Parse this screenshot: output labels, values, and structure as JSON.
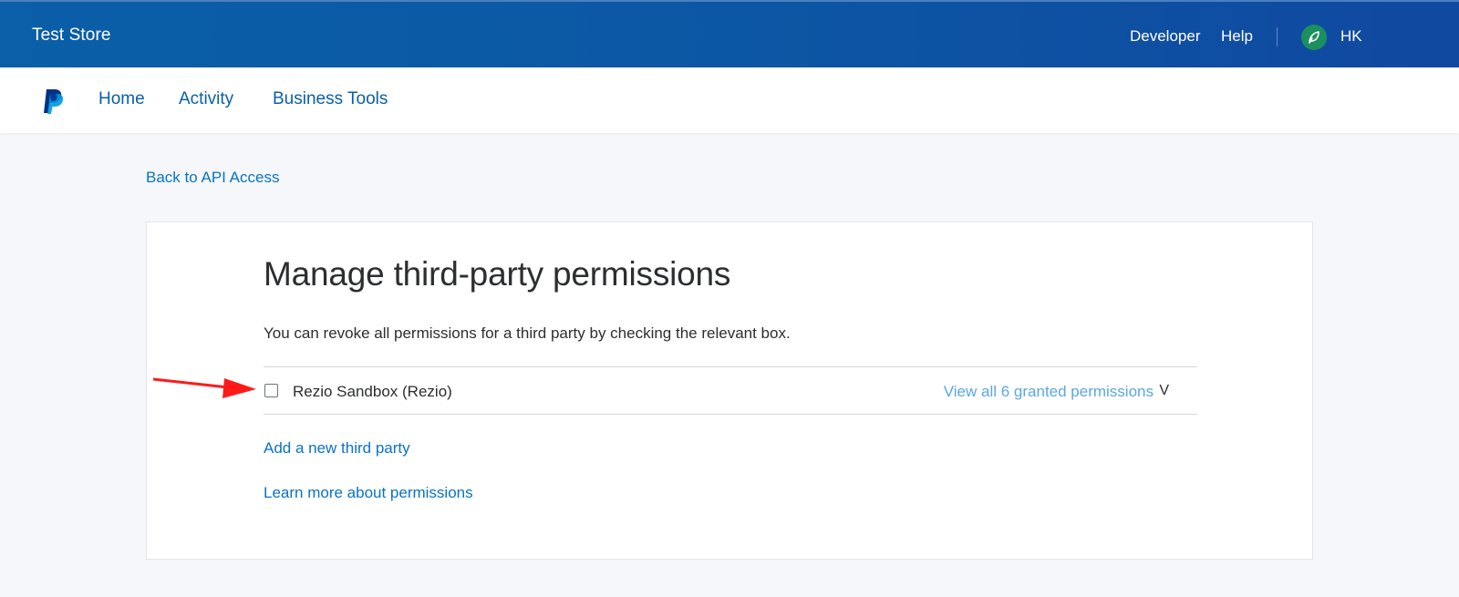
{
  "header": {
    "store_name": "Test Store",
    "developer_link": "Developer",
    "help_link": "Help",
    "user_initials": "HK"
  },
  "nav": {
    "items": [
      {
        "label": "Home"
      },
      {
        "label": "Activity"
      },
      {
        "label": "Business Tools"
      }
    ]
  },
  "back_link": "Back to API Access",
  "card": {
    "title": "Manage third-party permissions",
    "description": "You can revoke all permissions for a third party by checking the relevant box.",
    "permissions": [
      {
        "name": "Rezio Sandbox (Rezio)",
        "view_label": "View all 6 granted permissions",
        "chevron": "V",
        "checked": false
      }
    ],
    "add_link": "Add a new third party",
    "learn_link": "Learn more about permissions"
  },
  "colors": {
    "header_bg": "#0c57a5",
    "link": "#0a72c7",
    "nav_link": "#0a5fa8",
    "light_link": "#5aa7e6",
    "avatar_bg": "#1c8f5e",
    "annotation_arrow": "#ff1a1a"
  },
  "icons": {
    "logo": "paypal-logo-icon",
    "avatar": "leaf-avatar-icon",
    "annotation": "red-arrow-annotation"
  }
}
